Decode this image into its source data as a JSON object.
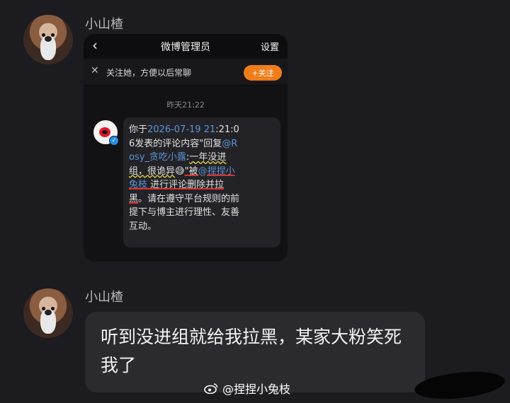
{
  "messages": [
    {
      "sender": "小山楂",
      "screenshot": {
        "title": "微博管理员",
        "settings": "设置",
        "follow_prompt": "关注她，方便以后常聊",
        "follow_button": "+关注",
        "timestamp": "昨天21:22",
        "message": {
          "part1": "你于",
          "date": "2026-07-19 21",
          "part2": ":21:06发表的评论内容\"回复",
          "mention1": "@Rosy_贪吃小露",
          "part3": ":",
          "quote": "一年没进组，很诡异",
          "emoji": "😅",
          "part4": "\"被",
          "mention2": "@捏捏小兔枝",
          "part5": " 进行",
          "deleted": "评论删除并拉黑",
          "part6": "。请在遵守平台规则的前提下与博主进行理性、友善互动。"
        }
      }
    },
    {
      "sender": "小山楂",
      "text": "听到没进组就给我拉黑，某家大粉笑死我了"
    }
  ],
  "watermark": "@捏捏小兔枝",
  "icons": [
    "back-icon",
    "close-icon",
    "weibo-icon",
    "verified-icon",
    "weibo-watermark-icon"
  ],
  "colors": {
    "follow": "#f07d1a",
    "link": "#5d93d6",
    "underline_red": "#e0302a",
    "underline_yellow": "#e8d84a"
  }
}
